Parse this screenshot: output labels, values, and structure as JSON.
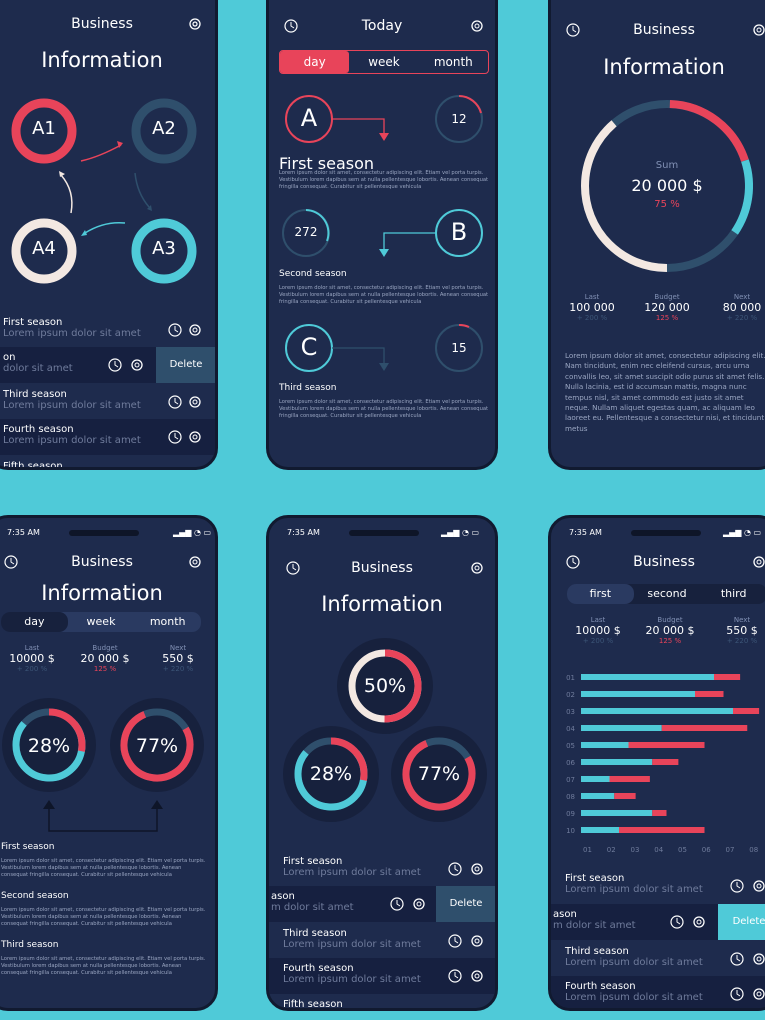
{
  "colors": {
    "bg": "#4fcad8",
    "panel": "#1e2b4d",
    "red": "#e8445a",
    "cyan": "#4fcad8",
    "cream": "#f3e8e2",
    "slate": "#2f4f6c"
  },
  "s1": {
    "title": "Business",
    "heading": "Information",
    "nodes": [
      "A1",
      "A2",
      "A4",
      "A3"
    ],
    "rows": [
      {
        "title": "First season",
        "sub": "Lorem ipsum dolor sit amet"
      },
      {
        "title": "on",
        "sub": "dolor sit amet",
        "action": "Delete"
      },
      {
        "title": "Third season",
        "sub": "Lorem ipsum dolor sit amet"
      },
      {
        "title": "Fourth season",
        "sub": "Lorem ipsum dolor sit amet"
      },
      {
        "title": "Fifth season",
        "sub": ""
      }
    ]
  },
  "s2": {
    "title": "Today",
    "tabs": [
      "day",
      "week",
      "month"
    ],
    "items": [
      {
        "letter": "A",
        "num": "12",
        "label": "First season"
      },
      {
        "letter": "B",
        "num": "272",
        "label": "Second season"
      },
      {
        "letter": "C",
        "num": "15",
        "label": "Third season"
      }
    ],
    "lorem": "Lorem ipsum dolor sit amet, consectetur adipiscing elit. Etiam vel porta turpis. Vestibulum lorem dapibus sem at nulla pellentesque lobortis. Aenean consequat fringilla consequat. Curabitur sit pellentesque vehicula"
  },
  "s3": {
    "title": "Business",
    "heading": "Information",
    "sum_label": "Sum",
    "sum_value": "20 000 $",
    "sum_pct": "75 %",
    "stats": [
      {
        "label": "Last",
        "value": "100 000",
        "pct": "+ 200 %"
      },
      {
        "label": "Budget",
        "value": "120 000",
        "pct": "125 %"
      },
      {
        "label": "Next",
        "value": "80 000",
        "pct": "+ 220 %"
      }
    ],
    "body": "Lorem ipsum dolor sit amet, consectetur adipiscing elit. Nam tincidunt, enim nec eleifend cursus, arcu urna convallis leo, sit amet suscipit odio purus sit amet felis. Nulla lacinia, est id accumsan mattis, magna nunc tempus nisl, sit amet commodo est justo sit amet neque. Nullam aliquet egestas quam, ac aliquam leo laoreet eu. Pellentesque a consectetur nisi, et tincidunt metus"
  },
  "s4": {
    "time": "7:35 AM",
    "title": "Business",
    "heading": "Information",
    "tabs": [
      "day",
      "week",
      "month"
    ],
    "stats": [
      {
        "label": "Last",
        "value": "10000 $",
        "pct": "+ 200 %"
      },
      {
        "label": "Budget",
        "value": "20 000 $",
        "pct": "125 %"
      },
      {
        "label": "Next",
        "value": "550 $",
        "pct": "+ 220 %"
      }
    ],
    "donuts": [
      "28%",
      "77%"
    ],
    "sections": [
      "First season",
      "Second season",
      "Third season"
    ],
    "lorem": "Lorem ipsum dolor sit amet, consectetur adipiscing elit. Etiam vel porta turpis. Vestibulum lorem dapibus sem at nulla pellentesque lobortis. Aenean consequat fringilla consequat. Curabitur sit pellentesque vehicula"
  },
  "s5": {
    "time": "7:35 AM",
    "title": "Business",
    "heading": "Information",
    "donuts": [
      "50%",
      "28%",
      "77%"
    ],
    "rows": [
      {
        "title": "First season",
        "sub": "Lorem ipsum dolor sit amet"
      },
      {
        "title": "ason",
        "sub": "m dolor sit amet",
        "action": "Delete"
      },
      {
        "title": "Third season",
        "sub": "Lorem ipsum dolor sit amet"
      },
      {
        "title": "Fourth season",
        "sub": "Lorem ipsum dolor sit amet"
      },
      {
        "title": "Fifth season",
        "sub": ""
      }
    ]
  },
  "s6": {
    "time": "7:35 AM",
    "title": "Business",
    "tabs": [
      "first",
      "second",
      "third"
    ],
    "stats": [
      {
        "label": "Last",
        "value": "10000 $",
        "pct": "+ 200 %"
      },
      {
        "label": "Budget",
        "value": "20 000 $",
        "pct": "125 %"
      },
      {
        "label": "Next",
        "value": "550 $",
        "pct": "+ 220 %"
      }
    ],
    "rows": [
      {
        "title": "First season",
        "sub": "Lorem ipsum dolor sit amet"
      },
      {
        "title": "ason",
        "sub": "m dolor sit amet",
        "action": "Delete"
      },
      {
        "title": "Third season",
        "sub": "Lorem ipsum dolor sit amet"
      },
      {
        "title": "Fourth season",
        "sub": "Lorem ipsum dolor sit amet"
      }
    ]
  },
  "chart_data": {
    "type": "bar",
    "orientation": "horizontal",
    "stacked": true,
    "categories": [
      "01",
      "02",
      "03",
      "04",
      "05",
      "06",
      "07",
      "08",
      "09",
      "10"
    ],
    "x_ticks": [
      "01",
      "02",
      "03",
      "04",
      "05",
      "06",
      "07",
      "08"
    ],
    "series": [
      {
        "values": [
          5.6,
          4.8,
          6.4,
          3.4,
          2.0,
          3.0,
          1.2,
          1.4,
          3.0,
          1.6
        ]
      },
      {
        "values": [
          1.1,
          1.2,
          1.1,
          3.6,
          3.2,
          1.1,
          1.7,
          0.9,
          0.6,
          3.6
        ]
      }
    ],
    "xlim": [
      0,
      8
    ]
  }
}
